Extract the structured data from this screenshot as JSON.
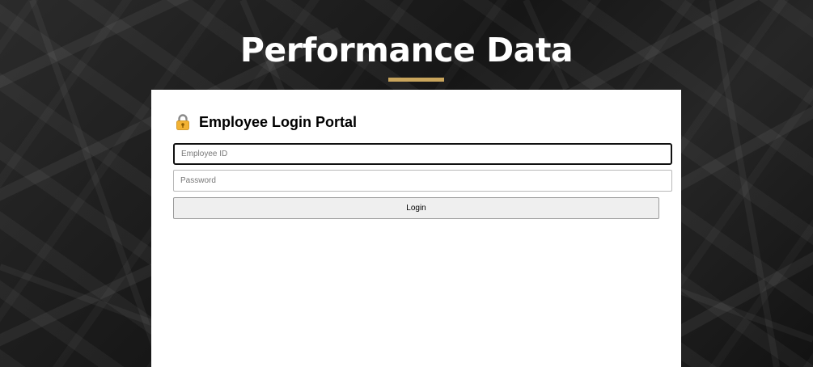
{
  "header": {
    "title": "Performance Data",
    "accent_color": "#c9a55c"
  },
  "login_card": {
    "heading_icon": "lock-icon",
    "heading": "Employee Login Portal",
    "employee_id": {
      "value": "",
      "placeholder": "Employee ID"
    },
    "password": {
      "value": "",
      "placeholder": "Password"
    },
    "login_label": "Login"
  }
}
